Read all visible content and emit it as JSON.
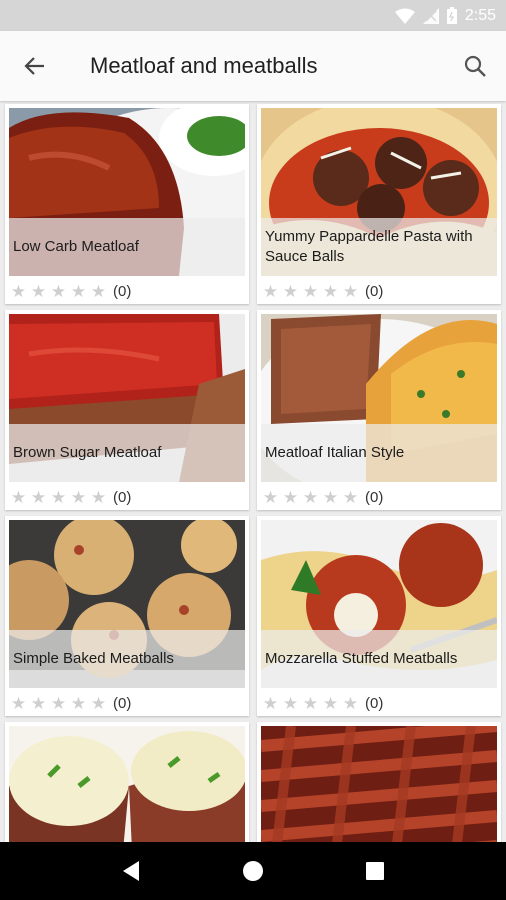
{
  "status_bar": {
    "time": "2:55",
    "icons": [
      "wifi-icon",
      "signal-icon",
      "battery-icon"
    ]
  },
  "app_bar": {
    "title": "Meatloaf and meatballs",
    "back_icon": "arrow-back-icon",
    "search_icon": "search-icon"
  },
  "recipes": [
    {
      "name": "Low Carb Meatloaf",
      "rating_count": "(0)",
      "stars": 0
    },
    {
      "name": "Yummy Pappardelle Pasta with Sauce Balls",
      "rating_count": "(0)",
      "stars": 0
    },
    {
      "name": "Brown Sugar Meatloaf",
      "rating_count": "(0)",
      "stars": 0
    },
    {
      "name": "Meatloaf Italian Style",
      "rating_count": "(0)",
      "stars": 0
    },
    {
      "name": "Simple Baked Meatballs",
      "rating_count": "(0)",
      "stars": 0
    },
    {
      "name": "Mozzarella Stuffed Meatballs",
      "rating_count": "(0)",
      "stars": 0
    },
    {
      "name": "",
      "rating_count": "",
      "stars": 0
    },
    {
      "name": "",
      "rating_count": "",
      "stars": 0
    }
  ],
  "nav_bar": {
    "back": "nav-back-icon",
    "home": "nav-home-icon",
    "recents": "nav-recents-icon"
  }
}
